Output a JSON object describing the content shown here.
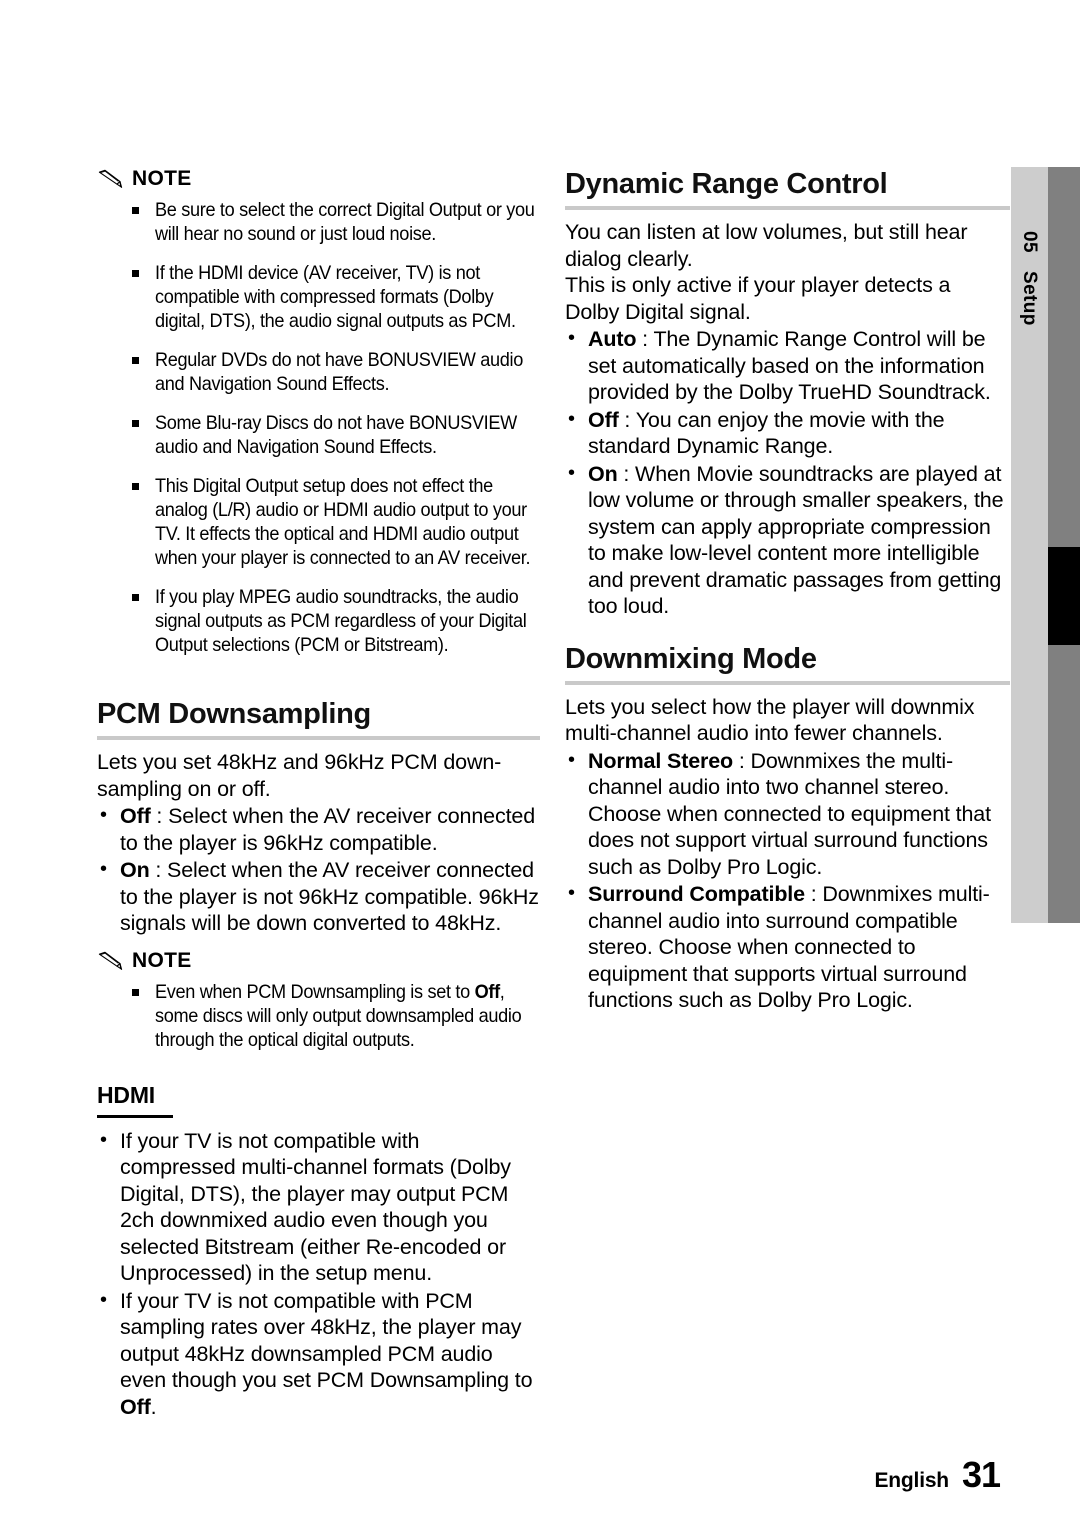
{
  "side_tab": {
    "number": "05",
    "label": "Setup"
  },
  "footer": {
    "language": "English",
    "page_number": "31"
  },
  "left_column": {
    "note_1": {
      "icon": "pencil-icon",
      "label": "NOTE",
      "items": [
        "Be sure to select the correct Digital Output or you will hear no sound or just loud noise.",
        "If the HDMI device (AV receiver, TV) is not compatible with compressed formats (Dolby digital, DTS), the audio signal outputs as PCM.",
        "Regular DVDs do not have BONUSVIEW audio and Navigation Sound Effects.",
        "Some Blu-ray Discs do not have BONUSVIEW audio and Navigation Sound Effects.",
        "This Digital Output setup does not effect the analog (L/R) audio or HDMI audio output to your TV. It effects the optical and HDMI audio output when your player is connected to an AV receiver.",
        "If you play MPEG audio soundtracks, the audio signal outputs as PCM regardless of your Digital Output selections (PCM or Bitstream)."
      ]
    },
    "pcm_downsampling": {
      "title": "PCM Downsampling",
      "intro": "Lets you set 48kHz and 96kHz PCM down-sampling on or off.",
      "bullets": [
        {
          "term": "Off",
          "sep": " : ",
          "text": "Select when the AV receiver connected to the player is 96kHz compatible."
        },
        {
          "term": "On",
          "sep": " : ",
          "text": "Select when the AV receiver connected to the player is not 96kHz compatible. 96kHz signals will be down converted to 48kHz."
        }
      ]
    },
    "note_2": {
      "icon": "pencil-icon",
      "label": "NOTE",
      "item_pre": "Even when PCM Downsampling is set to ",
      "item_bold": "Off",
      "item_post": ", some discs will only output downsampled audio through the optical digital outputs."
    },
    "hdmi": {
      "title": "HDMI",
      "bullet_1": "If your TV is not compatible with compressed multi-channel formats (Dolby Digital, DTS), the player may output PCM 2ch downmixed audio even though you selected Bitstream (either Re-encoded or Unprocessed) in the setup menu.",
      "bullet_2_pre": "If your TV is not compatible with PCM sampling rates over 48kHz, the player may output 48kHz downsampled PCM audio even though you set PCM Downsampling to ",
      "bullet_2_bold": "Off",
      "bullet_2_post": "."
    }
  },
  "right_column": {
    "dynamic_range_control": {
      "title": "Dynamic Range Control",
      "intro_1": "You can listen at low volumes, but still hear dialog clearly.",
      "intro_2": "This is only active if your player detects a Dolby Digital signal.",
      "bullets": [
        {
          "term": "Auto",
          "sep": " : ",
          "text": "The Dynamic Range Control will be set automatically based on the information provided by the Dolby TrueHD Soundtrack."
        },
        {
          "term": "Off",
          "sep": " : ",
          "text": "You can enjoy the movie with the standard Dynamic Range."
        },
        {
          "term": "On",
          "sep": " : ",
          "text": "When Movie soundtracks are played at low volume or through smaller speakers, the system can apply appropriate compression to make low-level content more intelligible and prevent dramatic passages from getting too loud."
        }
      ]
    },
    "downmixing_mode": {
      "title": "Downmixing Mode",
      "intro": "Lets you select how the player will downmix multi-channel audio into fewer channels.",
      "bullets": [
        {
          "term": "Normal Stereo",
          "sep": " : ",
          "text": "Downmixes the multi-channel audio into two channel stereo. Choose when connected to equipment that does not support virtual surround functions such as Dolby Pro Logic."
        },
        {
          "term": "Surround Compatible",
          "sep": " : ",
          "text": "Downmixes multi-channel audio into surround compatible stereo. Choose when connected to equipment that supports virtual surround functions such as Dolby Pro Logic."
        }
      ]
    }
  }
}
